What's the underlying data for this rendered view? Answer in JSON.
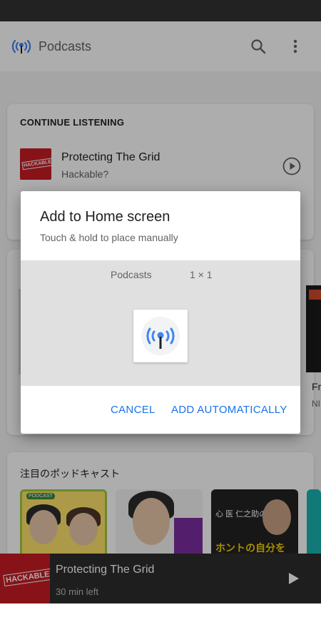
{
  "app_bar": {
    "title": "Podcasts",
    "icons": [
      "podcast-logo-icon",
      "search-icon",
      "more-vert-icon"
    ]
  },
  "continue_listening": {
    "heading": "CONTINUE LISTENING",
    "episode_title": "Protecting The Grid",
    "podcast_name": "Hackable?",
    "thumbnail_text": "HACKABLE?"
  },
  "peek": {
    "right_title_fragment": "Fr",
    "right_sub_fragment": "NI"
  },
  "featured": {
    "heading": "注目のポッドキャスト",
    "card1_badge": "PODCAST",
    "card3_top": "心 医 仁之助の",
    "card3_main": "ホントの自分を"
  },
  "mini_player": {
    "title": "Protecting The Grid",
    "time_left": "30 min left",
    "thumbnail_text": "HACKABLE?"
  },
  "dialog": {
    "title": "Add to Home screen",
    "subtitle": "Touch & hold to place manually",
    "widget_name": "Podcasts",
    "widget_size": "1 × 1",
    "cancel_label": "CANCEL",
    "add_label": "ADD AUTOMATICALLY"
  },
  "colors": {
    "accent": "#1a73e8",
    "podcast_blue": "#4285f4",
    "hackable_red": "#c81d25",
    "mini_player_bg": "#2d2d2d"
  }
}
